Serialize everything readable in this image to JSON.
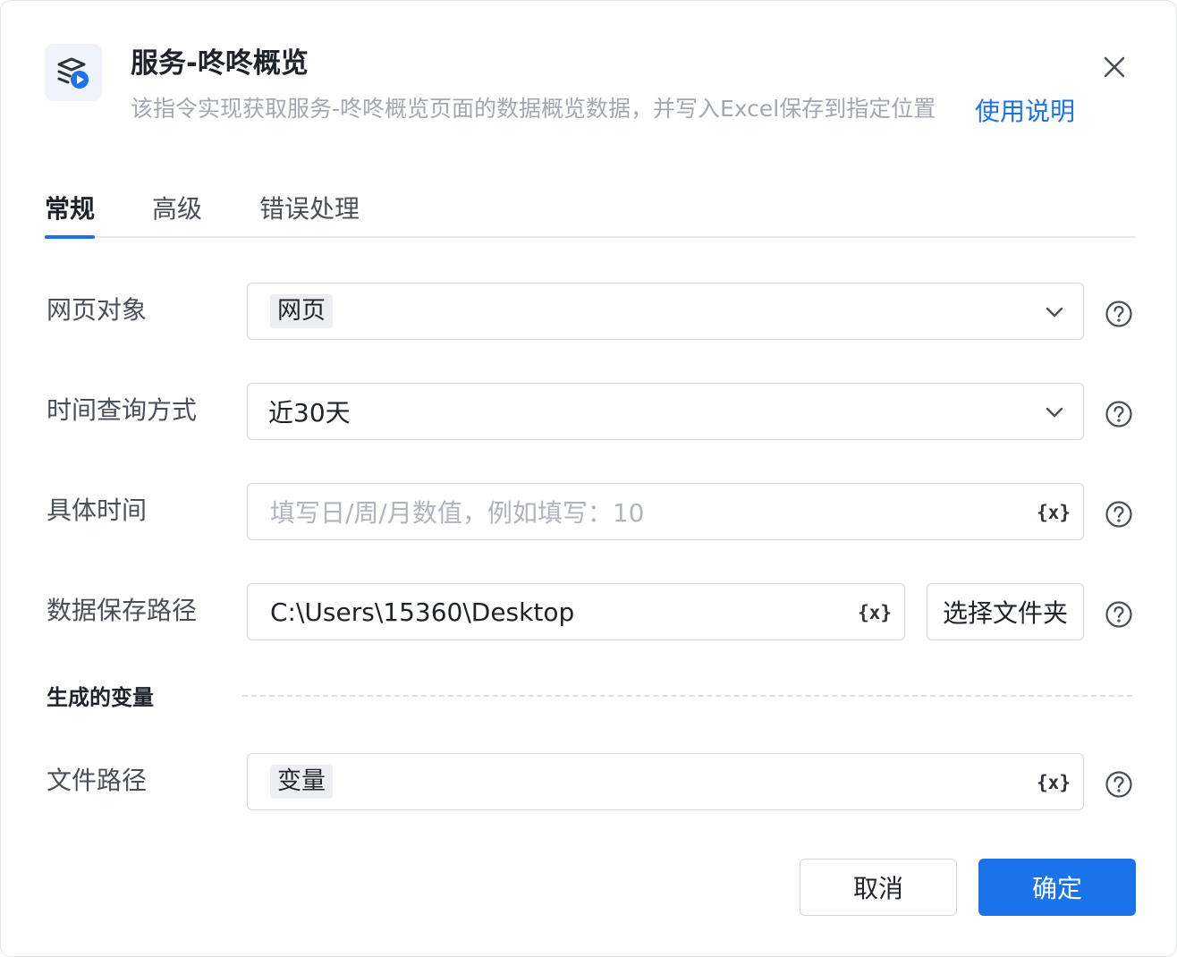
{
  "dialog": {
    "title": "服务-咚咚概览",
    "description": "该指令实现获取服务-咚咚概览页面的数据概览数据，并写入Excel保存到指定位置",
    "help_link": "使用说明",
    "app_icon": "layers-play-icon",
    "accent_color": "#1a73e8"
  },
  "tabs": [
    {
      "label": "常规",
      "active": true
    },
    {
      "label": "高级",
      "active": false
    },
    {
      "label": "错误处理",
      "active": false
    }
  ],
  "form": {
    "web_object": {
      "label": "网页对象",
      "value": "网页"
    },
    "time_query": {
      "label": "时间查询方式",
      "value": "近30天"
    },
    "specific_time": {
      "label": "具体时间",
      "value": "",
      "placeholder": "填写日/周/月数值，例如填写：10"
    },
    "save_path": {
      "label": "数据保存路径",
      "value": "C:\\Users\\15360\\Desktop",
      "button": "选择文件夹"
    },
    "variable_icon_text": "{x}"
  },
  "output": {
    "section_title": "生成的变量",
    "file_path": {
      "label": "文件路径",
      "value": "变量"
    }
  },
  "footer": {
    "cancel": "取消",
    "confirm": "确定"
  }
}
